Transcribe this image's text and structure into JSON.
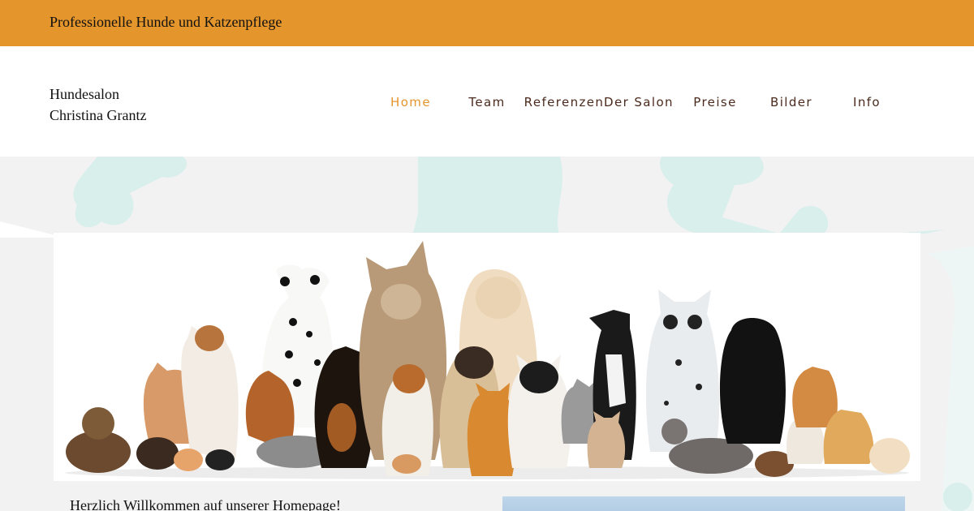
{
  "topbar": {
    "tagline": "Professionelle Hunde und Katzenpflege"
  },
  "brand": {
    "line1": "Hundesalon",
    "line2": "Christina Grantz"
  },
  "nav": {
    "items": [
      {
        "label": "Home",
        "active": true
      },
      {
        "label": "Team",
        "active": false
      },
      {
        "label": "Referenzen",
        "active": false
      },
      {
        "label": "Der Salon",
        "active": false
      },
      {
        "label": "Preise",
        "active": false
      },
      {
        "label": "Bilder",
        "active": false
      },
      {
        "label": "Info",
        "active": false
      }
    ]
  },
  "colors": {
    "accent": "#e4952b",
    "nav_text": "#4a2a1d",
    "hero_bg": "#f2f2f2",
    "decor_mint": "#d8efec"
  },
  "main": {
    "welcome": "Herzlich Willkommen auf unserer Homepage!"
  }
}
